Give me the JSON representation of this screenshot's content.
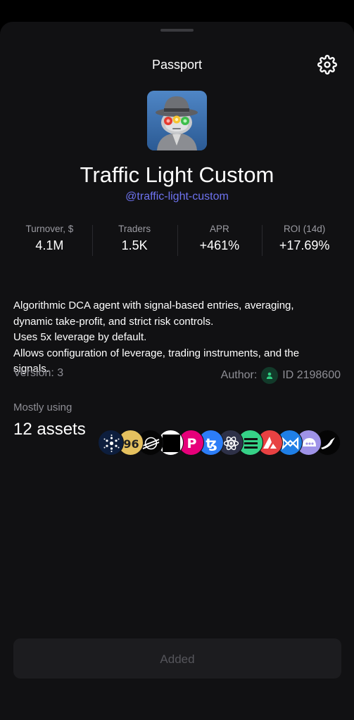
{
  "header": {
    "title": "Passport"
  },
  "agent": {
    "name": "Traffic Light Custom",
    "handle": "@traffic-light-custom"
  },
  "stats": [
    {
      "label": "Turnover, $",
      "value": "4.1M"
    },
    {
      "label": "Traders",
      "value": "1.5K"
    },
    {
      "label": "APR",
      "value": "+461%"
    },
    {
      "label": "ROI (14d)",
      "value": "+17.69%"
    }
  ],
  "description": {
    "line1": "Algorithmic DCA agent with signal-based entries, averaging,",
    "line2": "dynamic take-profit, and strict risk controls.",
    "line3": "Uses 5x leverage by default.",
    "line4": "Allows configuration of leverage, trading instruments, and the",
    "line5": "signals."
  },
  "meta": {
    "version": "Version: 3",
    "author_label": "Author:",
    "author_id": "ID 2198600"
  },
  "assets": {
    "label": "Mostly using",
    "count": "12 assets",
    "icons": [
      "cardano-icon",
      "chainlink-icon",
      "stellar-icon",
      "ton-icon",
      "polkadot-icon",
      "tezos-icon",
      "cosmos-icon",
      "solana-icon",
      "avalanche-icon",
      "cronos-icon",
      "lido-icon",
      "swallow-icon"
    ]
  },
  "footer": {
    "button_label": "Added"
  },
  "colors": {
    "accent": "#6e73f0",
    "background": "#111113",
    "muted": "#8e8e95"
  }
}
